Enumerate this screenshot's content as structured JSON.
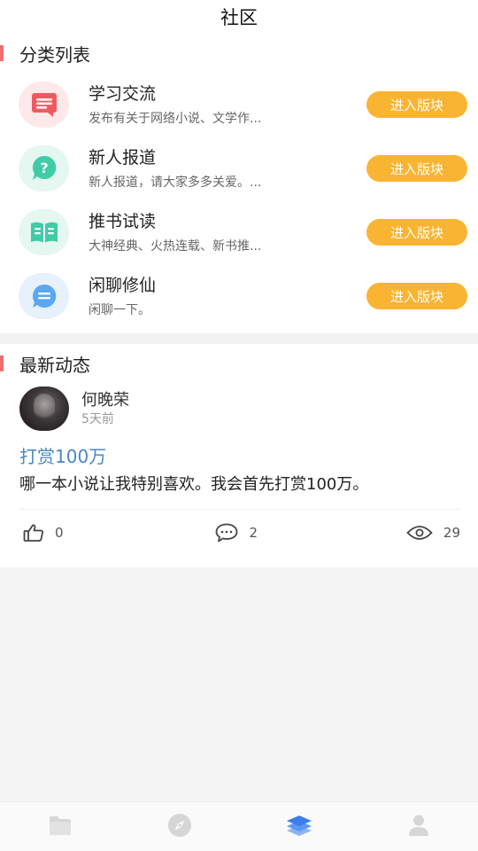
{
  "header": {
    "title": "社区"
  },
  "categories": {
    "section_title": "分类列表",
    "items": [
      {
        "name": "学习交流",
        "desc": "发布有关于网络小说、文学作...",
        "button": "进入版块",
        "icon": "document-icon",
        "icon_bg": "#fde8ea",
        "icon_color": "#ef5a5f"
      },
      {
        "name": "新人报道",
        "desc": "新人报道，请大家多多关爱。...",
        "button": "进入版块",
        "icon": "question-icon",
        "icon_bg": "#e4f7f1",
        "icon_color": "#3fcca6"
      },
      {
        "name": "推书试读",
        "desc": "大神经典、火热连载、新书推...",
        "button": "进入版块",
        "icon": "book-icon",
        "icon_bg": "#e4f7f1",
        "icon_color": "#3fcca6"
      },
      {
        "name": "闲聊修仙",
        "desc": "闲聊一下。",
        "button": "进入版块",
        "icon": "chat-icon",
        "icon_bg": "#e6f1fd",
        "icon_color": "#59a8f2"
      }
    ]
  },
  "feed": {
    "section_title": "最新动态",
    "post": {
      "user": "何晚荣",
      "time": "5天前",
      "title": "打赏100万",
      "body": "哪一本小说让我特别喜欢。我会首先打赏100万。",
      "likes": "0",
      "comments": "2",
      "views": "29"
    }
  },
  "tabbar": {
    "tabs": [
      {
        "icon": "bookshelf-icon",
        "active": false
      },
      {
        "icon": "compass-icon",
        "active": false
      },
      {
        "icon": "community-layers-icon",
        "active": true
      },
      {
        "icon": "profile-icon",
        "active": false
      }
    ]
  },
  "colors": {
    "accent_button": "#f9b431",
    "section_bar": "#ef6f6f",
    "post_title": "#4a86c5",
    "tab_active": "#3b7ded",
    "tab_inactive": "#d6d6d6"
  }
}
